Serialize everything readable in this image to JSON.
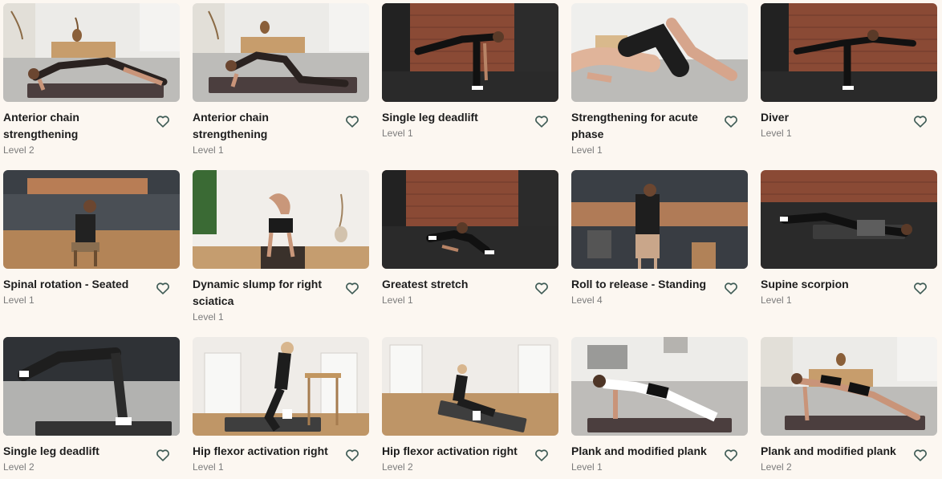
{
  "colors": {
    "background": "#fcf7f1",
    "title": "#1d1d1d",
    "level": "#7b7b7b",
    "heart": "#3d5a54"
  },
  "cards": [
    {
      "title": "Anterior chain strengthening",
      "level": "Level 2",
      "icon": "heart-outline-icon"
    },
    {
      "title": "Anterior chain strengthening",
      "level": "Level 1",
      "icon": "heart-outline-icon"
    },
    {
      "title": "Single leg deadlift",
      "level": "Level 1",
      "icon": "heart-outline-icon"
    },
    {
      "title": "Strengthening for acute phase",
      "level": "Level 1",
      "icon": "heart-outline-icon"
    },
    {
      "title": "Diver",
      "level": "Level 1",
      "icon": "heart-outline-icon"
    },
    {
      "title": "Spinal rotation - Seated",
      "level": "Level 1",
      "icon": "heart-outline-icon"
    },
    {
      "title": "Dynamic slump for right sciatica",
      "level": "Level 1",
      "icon": "heart-outline-icon"
    },
    {
      "title": "Greatest stretch",
      "level": "Level 1",
      "icon": "heart-outline-icon"
    },
    {
      "title": "Roll to release - Standing",
      "level": "Level 4",
      "icon": "heart-outline-icon"
    },
    {
      "title": "Supine scorpion",
      "level": "Level 1",
      "icon": "heart-outline-icon"
    },
    {
      "title": "Single leg deadlift",
      "level": "Level 2",
      "icon": "heart-outline-icon"
    },
    {
      "title": "Hip flexor activation right",
      "level": "Level 1",
      "icon": "heart-outline-icon"
    },
    {
      "title": "Hip flexor activation right",
      "level": "Level 2",
      "icon": "heart-outline-icon"
    },
    {
      "title": "Plank and modified plank",
      "level": "Level 1",
      "icon": "heart-outline-icon"
    },
    {
      "title": "Plank and modified plank",
      "level": "Level 2",
      "icon": "heart-outline-icon"
    }
  ]
}
